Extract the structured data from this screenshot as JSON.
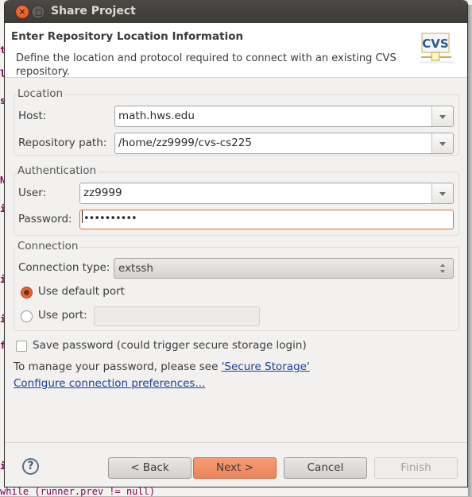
{
  "window": {
    "title": "Share Project",
    "close_icon": "close-icon",
    "maximize_icon": "maximize-icon"
  },
  "header": {
    "title": "Enter Repository Location Information",
    "description": "Define the location and protocol required to connect with an existing CVS repository.",
    "icon": "cvs-repository-icon",
    "icon_text": "CVS"
  },
  "location": {
    "group_label": "Location",
    "host_label": "Host:",
    "host_value": "math.hws.edu",
    "repo_path_label": "Repository path:",
    "repo_path_value": "/home/zz9999/cvs-cs225"
  },
  "authentication": {
    "group_label": "Authentication",
    "user_label": "User:",
    "user_value": "zz9999",
    "password_label": "Password:",
    "password_value": "••••••••••"
  },
  "connection": {
    "group_label": "Connection",
    "type_label": "Connection type:",
    "type_value": "extssh",
    "default_port_label": "Use default port",
    "default_port_selected": true,
    "use_port_label": "Use port:",
    "use_port_selected": false,
    "port_value": ""
  },
  "options": {
    "save_password_label": "Save password (could trigger secure storage login)",
    "save_password_checked": false,
    "manage_text": "To manage your password, please see ",
    "secure_storage_link": "'Secure Storage'",
    "configure_link": "Configure connection preferences..."
  },
  "footer": {
    "help_icon": "help-icon",
    "back_label": "< Back",
    "next_label": "Next >",
    "cancel_label": "Cancel",
    "finish_label": "Finish"
  },
  "background": {
    "code_line": "while (runner.prev != null)"
  }
}
